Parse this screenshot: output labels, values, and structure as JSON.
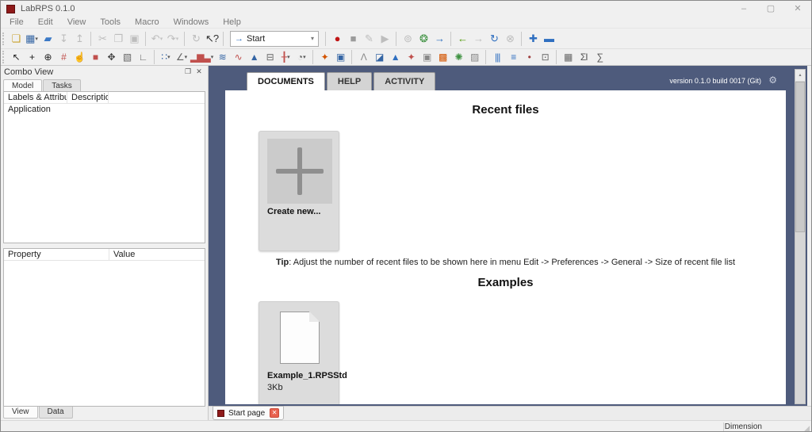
{
  "window": {
    "title": "LabRPS 0.1.0",
    "controls": {
      "minimize": "–",
      "maximize": "▢",
      "close": "✕"
    }
  },
  "menu": {
    "items": [
      "File",
      "Edit",
      "View",
      "Tools",
      "Macro",
      "Windows",
      "Help"
    ]
  },
  "icons": {
    "gear": "⚙",
    "scroll_up": "▴",
    "float_panel": "❐",
    "close_panel": "✕",
    "close_tab": "✕",
    "resize_grip": "◢",
    "wb_arrow": "→",
    "wb_chevron": "▾"
  },
  "toolbar1": {
    "workbench_label": "Start",
    "left": [
      {
        "name": "new-document-button",
        "glyph": "❏",
        "color": "#c9a12c"
      },
      {
        "name": "workbench-grid-button",
        "glyph": "▦",
        "color": "#3465a4",
        "dropdown": true
      },
      {
        "name": "open-file-button",
        "glyph": "▰",
        "color": "#3b79c6"
      },
      {
        "name": "import-button",
        "glyph": "↧",
        "enabled": false
      },
      {
        "name": "export-button",
        "glyph": "↥",
        "enabled": false
      },
      {
        "sep": true
      },
      {
        "name": "cut-button",
        "glyph": "✂",
        "enabled": false
      },
      {
        "name": "copy-button",
        "glyph": "❐",
        "enabled": false
      },
      {
        "name": "paste-button",
        "glyph": "▣",
        "enabled": false
      },
      {
        "sep": true
      },
      {
        "name": "undo-button",
        "glyph": "↶",
        "enabled": false,
        "dropdown": true
      },
      {
        "name": "redo-button",
        "glyph": "↷",
        "enabled": false,
        "dropdown": true
      },
      {
        "sep": true
      },
      {
        "name": "refresh-button",
        "glyph": "↻",
        "enabled": false
      },
      {
        "name": "whats-this-button",
        "glyph": "↖?",
        "color": "#333"
      },
      {
        "sep": true
      }
    ],
    "right": [
      {
        "sep": true
      },
      {
        "name": "macro-record-button",
        "glyph": "●",
        "color": "#c01616"
      },
      {
        "name": "macro-stop-button",
        "glyph": "■",
        "color": "#9b9b9b"
      },
      {
        "name": "macro-edit-button",
        "glyph": "✎",
        "enabled": false
      },
      {
        "name": "macro-play-button",
        "glyph": "▶",
        "enabled": false
      },
      {
        "sep": true
      },
      {
        "name": "web-home-button",
        "glyph": "⊚",
        "enabled": false
      },
      {
        "name": "web-browser-button",
        "glyph": "❂",
        "color": "#3d9140"
      },
      {
        "name": "start-page-button",
        "glyph": "→",
        "color": "#2f6fc0"
      },
      {
        "sep": true
      },
      {
        "name": "nav-back-button",
        "glyph": "←",
        "color": "#4e9a06"
      },
      {
        "name": "nav-forward-button",
        "glyph": "→",
        "enabled": false
      },
      {
        "name": "web-refresh-button",
        "glyph": "↻",
        "color": "#2f6fc0"
      },
      {
        "name": "web-stop-button",
        "glyph": "⊗",
        "enabled": false
      },
      {
        "sep": true
      },
      {
        "name": "zoom-in-button",
        "glyph": "✚",
        "color": "#2f6fc0"
      },
      {
        "name": "zoom-out-button",
        "glyph": "▬",
        "color": "#2f6fc0"
      }
    ]
  },
  "toolbar2": {
    "items": [
      {
        "name": "select-mode-button",
        "glyph": "↖",
        "color": "#222"
      },
      {
        "name": "crosshair-button",
        "glyph": "+",
        "color": "#222"
      },
      {
        "name": "center-point-button",
        "glyph": "⊕",
        "color": "#222"
      },
      {
        "name": "grid-toggle-button",
        "glyph": "#",
        "color": "#c0504d"
      },
      {
        "name": "pan-button",
        "glyph": "☝",
        "color": "#666"
      },
      {
        "name": "box-3d-button",
        "glyph": "■",
        "color": "#c0504d"
      },
      {
        "name": "move-view-button",
        "glyph": "✥",
        "color": "#444"
      },
      {
        "name": "zoom-region-button",
        "glyph": "▧",
        "color": "#666"
      },
      {
        "name": "fit-view-button",
        "glyph": "∟",
        "color": "#666"
      },
      {
        "sep": true
      },
      {
        "name": "scatter-plot-button",
        "glyph": "∷",
        "color": "#3465a4",
        "dropdown": true
      },
      {
        "name": "line-plot-button",
        "glyph": "∠",
        "color": "#666",
        "dropdown": true
      },
      {
        "name": "bar-chart-button",
        "glyph": "▂▆▃",
        "color": "#c0504d",
        "dropdown": true
      },
      {
        "name": "multi-line-plot-button",
        "glyph": "≋",
        "color": "#3465a4"
      },
      {
        "name": "wave-plot-button",
        "glyph": "∿",
        "color": "#c0504d"
      },
      {
        "name": "area-plot-button",
        "glyph": "▲",
        "color": "#3465a4"
      },
      {
        "name": "box-plot-button",
        "glyph": "⊟",
        "color": "#666"
      },
      {
        "name": "error-bar-plot-button",
        "glyph": "╂",
        "color": "#c0504d",
        "dropdown": true
      },
      {
        "name": "pie-chart-button",
        "glyph": "◔",
        "color": "#666",
        "dropdown": true
      },
      {
        "sep": true
      },
      {
        "name": "hex-3d-plot-button",
        "glyph": "✦",
        "color": "#d35400"
      },
      {
        "name": "cube-3d-plot-button",
        "glyph": "▣",
        "color": "#3465a4"
      },
      {
        "sep": true
      },
      {
        "name": "wireframe-plot-button",
        "glyph": "Λ",
        "color": "#888"
      },
      {
        "name": "surface-plot-button",
        "glyph": "◪",
        "color": "#3465a4"
      },
      {
        "name": "cone-plot-button",
        "glyph": "▲",
        "color": "#2f6fc0"
      },
      {
        "name": "hex-3d-plot-2-button",
        "glyph": "✦",
        "color": "#c0504d"
      },
      {
        "name": "cube-3d-plot-2-button",
        "glyph": "▣",
        "color": "#888"
      },
      {
        "name": "heatmap-plot-button",
        "glyph": "▩",
        "color": "#d35400"
      },
      {
        "name": "radial-scatter-button",
        "glyph": "✺",
        "color": "#3d9140"
      },
      {
        "name": "mosaic-plot-button",
        "glyph": "▨",
        "color": "#888"
      },
      {
        "sep": true
      },
      {
        "name": "vertical-lines-button",
        "glyph": "|||",
        "color": "#2f6fc0"
      },
      {
        "name": "horizontal-lines-button",
        "glyph": "≡",
        "color": "#2f6fc0"
      },
      {
        "name": "point-style-button",
        "glyph": "•",
        "color": "#a04040"
      },
      {
        "name": "screen-view-button",
        "glyph": "⊡",
        "color": "#666"
      },
      {
        "sep": true
      },
      {
        "name": "data-table-button",
        "glyph": "▦",
        "color": "#666"
      },
      {
        "name": "sum-column-button",
        "glyph": "ΣΙ",
        "color": "#555"
      },
      {
        "name": "sum-rows-button",
        "glyph": "∑",
        "color": "#555"
      }
    ]
  },
  "combo_view": {
    "title": "Combo View",
    "tabs": [
      "Model",
      "Tasks"
    ],
    "tree_columns": [
      "Labels & Attributes",
      "Description"
    ],
    "tree_items": [
      "Application"
    ],
    "prop_columns": [
      "Property",
      "Value"
    ],
    "bottom_tabs": [
      "View",
      "Data"
    ]
  },
  "main": {
    "tabs": [
      "DOCUMENTS",
      "HELP",
      "ACTIVITY"
    ],
    "active_tab": "DOCUMENTS",
    "version": "version 0.1.0 build 0017 (Git)",
    "recent_title": "Recent files",
    "create_label": "Create new...",
    "tip_bold": "Tip",
    "tip_text": ": Adjust the number of recent files to be shown here in menu Edit -> Preferences -> General -> Size of recent file list",
    "examples_title": "Examples",
    "example_name": "Example_1.RPSStd",
    "example_size": "3Kb"
  },
  "start_tab": {
    "label": "Start page"
  },
  "statusbar": {
    "dimension": "Dimension"
  },
  "colors": {
    "mdi_background": "#4e5b7c",
    "chrome": "#f0f0f0",
    "card": "#dcdcdc",
    "accent_blue": "#2f6fc0",
    "record_red": "#c01616",
    "disabled_gray": "#bdbdbd",
    "app_icon_red": "#8f1a1a"
  }
}
